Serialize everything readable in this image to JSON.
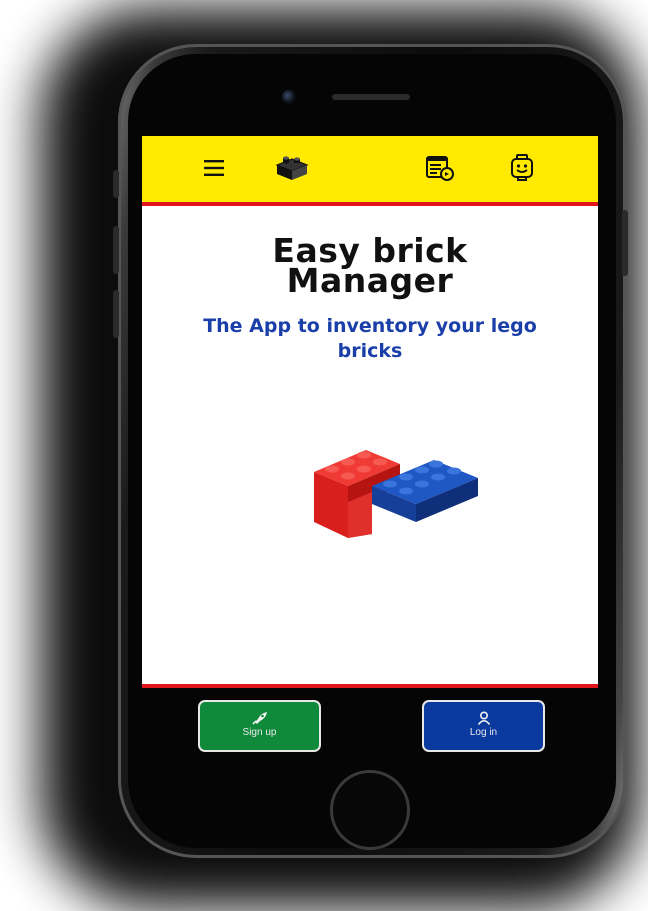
{
  "app": {
    "title": "Easy brick Manager",
    "title_line1": "Easy brick",
    "title_line2": "Manager",
    "subtitle": "The App to inventory your lego bricks"
  },
  "topbar": {
    "icons": [
      "menu-icon",
      "brick-icon",
      "inventory-icon",
      "minifig-face-icon"
    ]
  },
  "buttons": {
    "signup_label": "Sign up",
    "login_label": "Log in"
  },
  "colors": {
    "topbar": "#ffea00",
    "accent_red": "#e0161b",
    "subtitle_blue": "#1a3fa8",
    "signup_green": "#0f8a3a",
    "login_blue": "#0a3a9e"
  }
}
